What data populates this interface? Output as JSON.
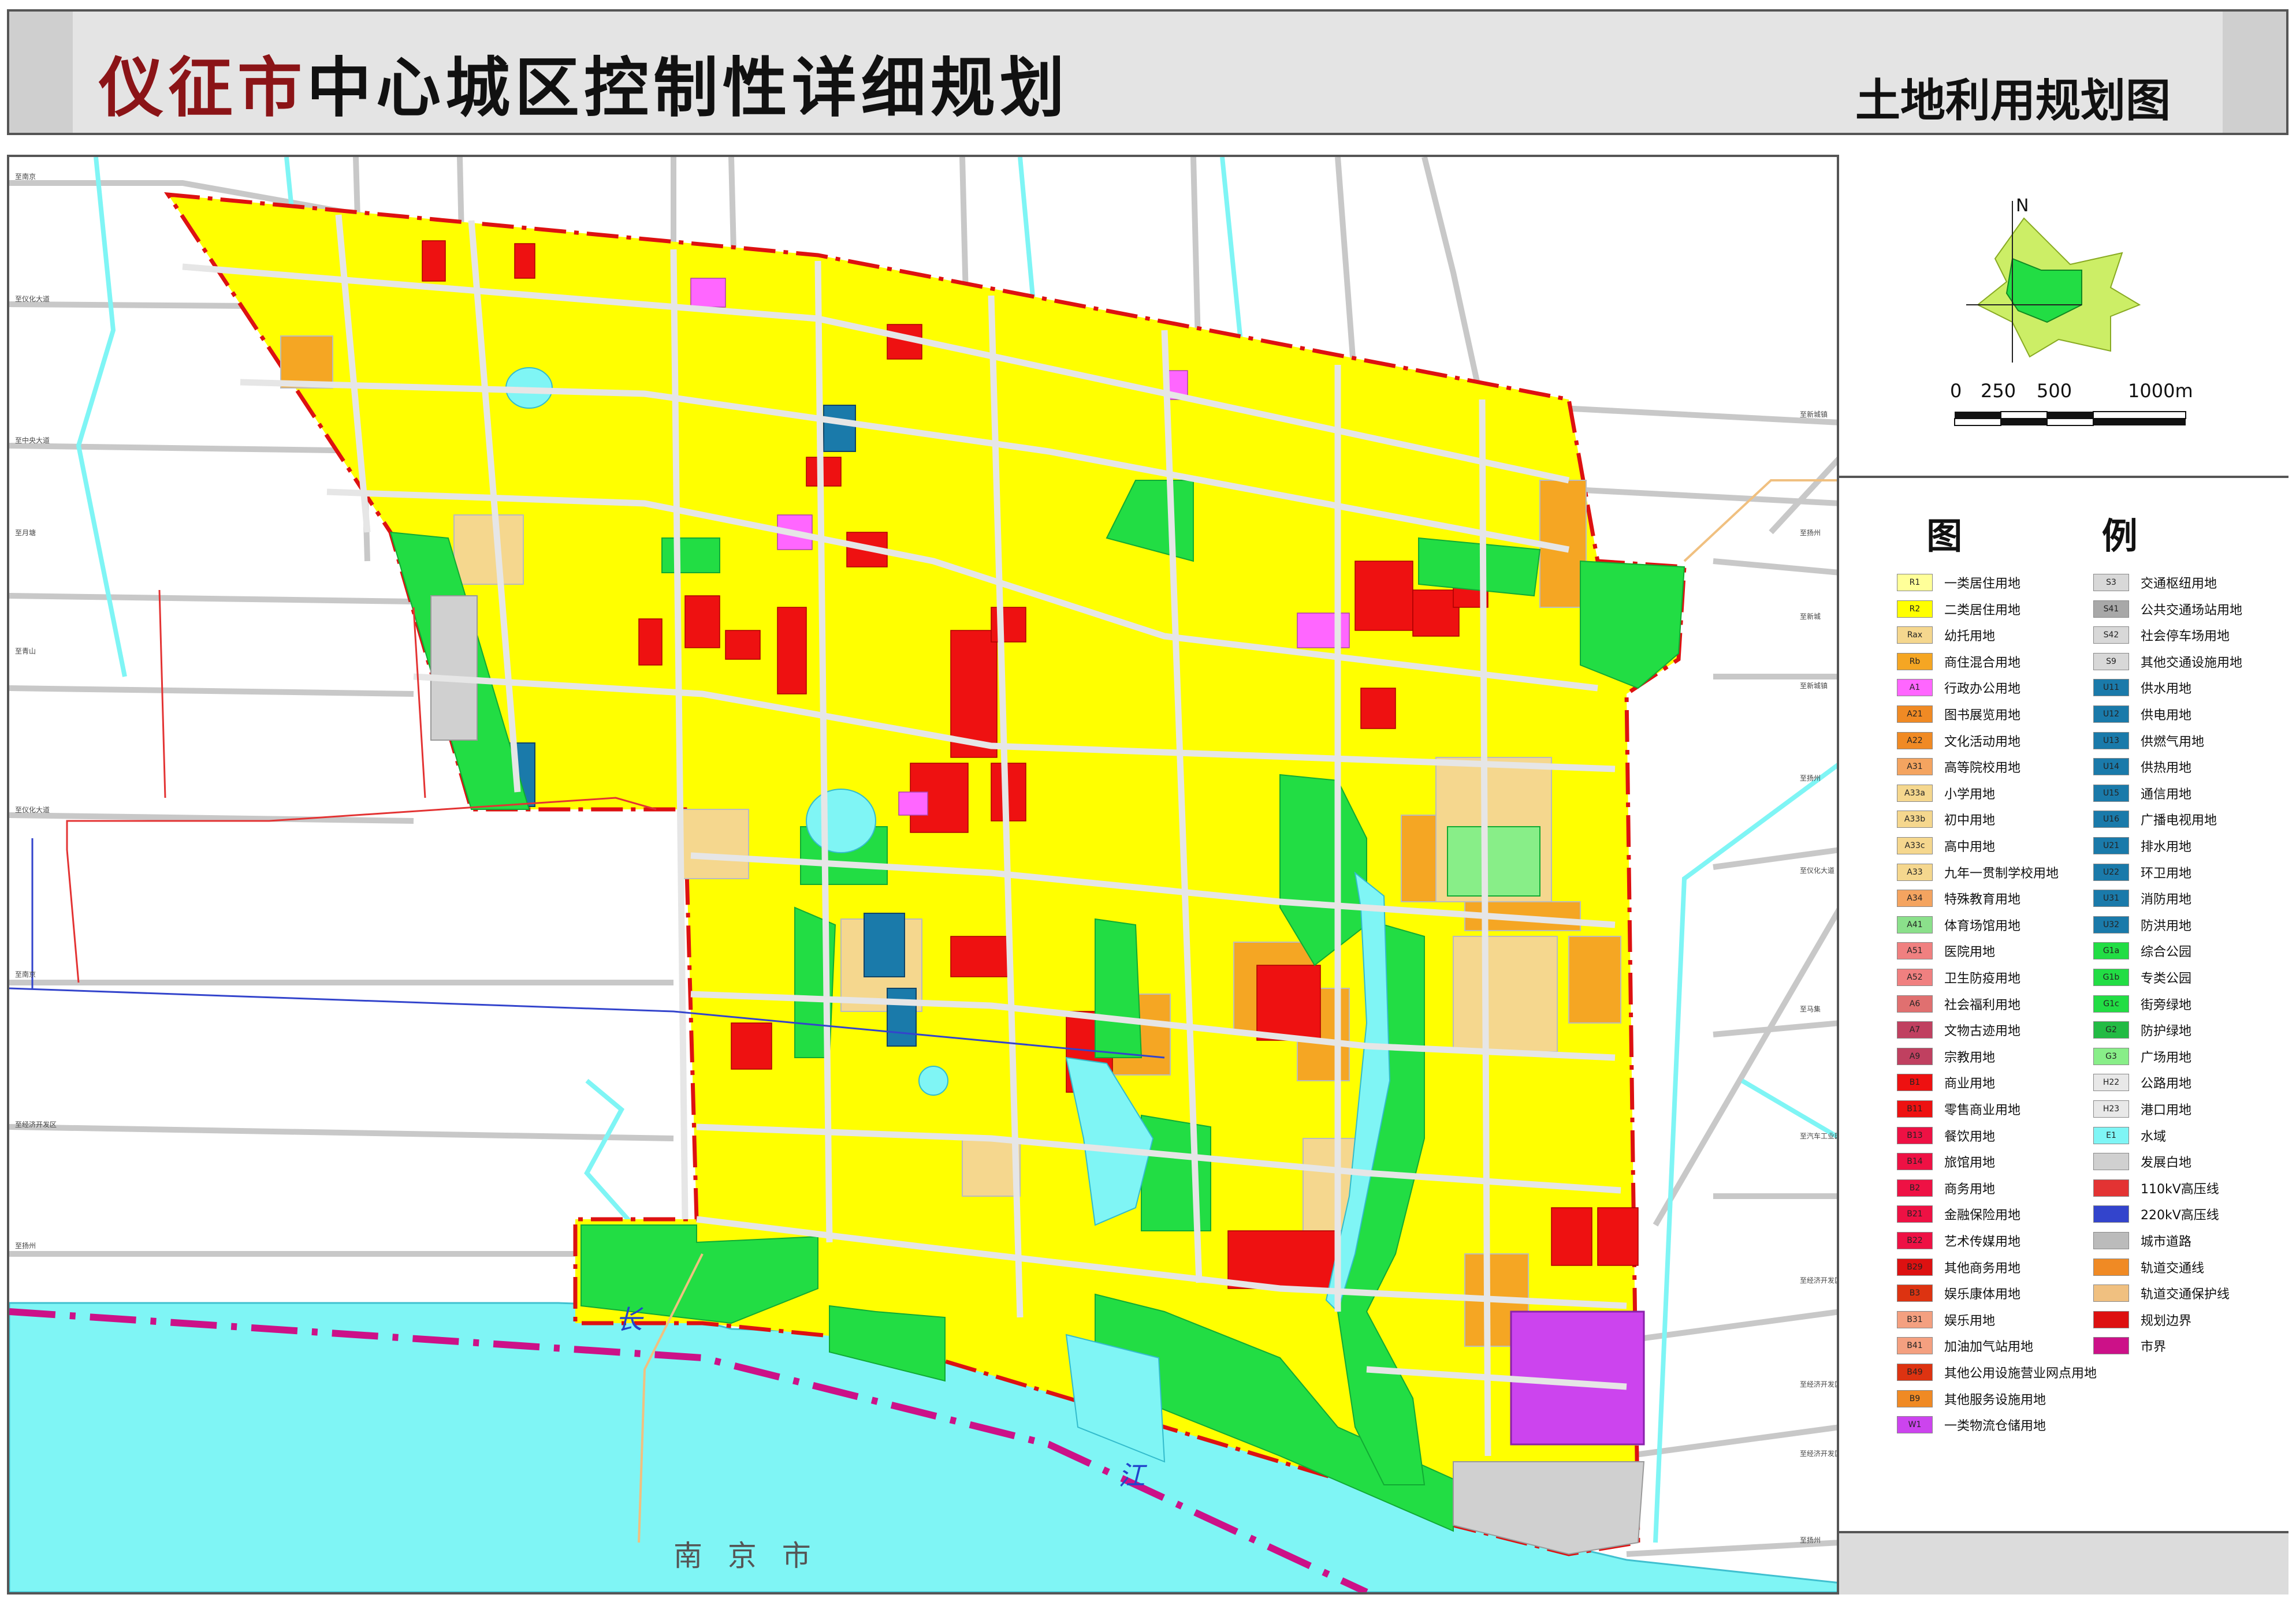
{
  "title": {
    "city": "仪征市",
    "main": "中心城区控制性详细规划",
    "subtitle": "土地利用规划图"
  },
  "compass": {
    "north": "N"
  },
  "scale_bar": {
    "ticks": [
      "0",
      "250",
      "500",
      "1000m"
    ]
  },
  "legend": {
    "title": "图  例",
    "left": [
      {
        "code": "R1",
        "label": "一类居住用地",
        "color": "#ffff99"
      },
      {
        "code": "R2",
        "label": "二类居住用地",
        "color": "#ffff00"
      },
      {
        "code": "Rax",
        "label": "幼托用地",
        "color": "#f5d78e"
      },
      {
        "code": "Rb",
        "label": "商住混合用地",
        "color": "#f5a623"
      },
      {
        "code": "A1",
        "label": "行政办公用地",
        "color": "#ff66ff"
      },
      {
        "code": "A21",
        "label": "图书展览用地",
        "color": "#f08a24"
      },
      {
        "code": "A22",
        "label": "文化活动用地",
        "color": "#f08a24"
      },
      {
        "code": "A31",
        "label": "高等院校用地",
        "color": "#f4a460"
      },
      {
        "code": "A33a",
        "label": "小学用地",
        "color": "#f5d78e"
      },
      {
        "code": "A33b",
        "label": "初中用地",
        "color": "#f5d78e"
      },
      {
        "code": "A33c",
        "label": "高中用地",
        "color": "#f5d78e"
      },
      {
        "code": "A33",
        "label": "九年一贯制学校用地",
        "color": "#f5d78e"
      },
      {
        "code": "A34",
        "label": "特殊教育用地",
        "color": "#f4a460"
      },
      {
        "code": "A41",
        "label": "体育场馆用地",
        "color": "#8be08b"
      },
      {
        "code": "A51",
        "label": "医院用地",
        "color": "#f08080"
      },
      {
        "code": "A52",
        "label": "卫生防疫用地",
        "color": "#f08080"
      },
      {
        "code": "A6",
        "label": "社会福利用地",
        "color": "#e07070"
      },
      {
        "code": "A7",
        "label": "文物古迹用地",
        "color": "#c04060"
      },
      {
        "code": "A9",
        "label": "宗教用地",
        "color": "#c04060"
      },
      {
        "code": "B1",
        "label": "商业用地",
        "color": "#ee1111"
      },
      {
        "code": "B11",
        "label": "零售商业用地",
        "color": "#ee1111"
      },
      {
        "code": "B13",
        "label": "餐饮用地",
        "color": "#ee1144"
      },
      {
        "code": "B14",
        "label": "旅馆用地",
        "color": "#ee1144"
      },
      {
        "code": "B2",
        "label": "商务用地",
        "color": "#ee1144"
      },
      {
        "code": "B21",
        "label": "金融保险用地",
        "color": "#ee1144"
      },
      {
        "code": "B22",
        "label": "艺术传媒用地",
        "color": "#ee1144"
      },
      {
        "code": "B29",
        "label": "其他商务用地",
        "color": "#dd1111"
      },
      {
        "code": "B3",
        "label": "娱乐康体用地",
        "color": "#dd3311"
      },
      {
        "code": "B31",
        "label": "娱乐用地",
        "color": "#f4a080"
      },
      {
        "code": "B41",
        "label": "加油加气站用地",
        "color": "#f4a080"
      },
      {
        "code": "B49",
        "label": "其他公用设施营业网点用地",
        "color": "#dd3311"
      },
      {
        "code": "B9",
        "label": "其他服务设施用地",
        "color": "#f08a24"
      },
      {
        "code": "W1",
        "label": "一类物流仓储用地",
        "color": "#cc44ee"
      }
    ],
    "right": [
      {
        "code": "S3",
        "label": "交通枢纽用地",
        "color": "#d8d8d8"
      },
      {
        "code": "S41",
        "label": "公共交通场站用地",
        "color": "#a8a8a8"
      },
      {
        "code": "S42",
        "label": "社会停车场用地",
        "color": "#d8d8d8"
      },
      {
        "code": "S9",
        "label": "其他交通设施用地",
        "color": "#d8d8d8"
      },
      {
        "code": "U11",
        "label": "供水用地",
        "color": "#1a7aaa"
      },
      {
        "code": "U12",
        "label": "供电用地",
        "color": "#1a7aaa"
      },
      {
        "code": "U13",
        "label": "供燃气用地",
        "color": "#1a7aaa"
      },
      {
        "code": "U14",
        "label": "供热用地",
        "color": "#1a7aaa"
      },
      {
        "code": "U15",
        "label": "通信用地",
        "color": "#1a7aaa"
      },
      {
        "code": "U16",
        "label": "广播电视用地",
        "color": "#1a7aaa"
      },
      {
        "code": "U21",
        "label": "排水用地",
        "color": "#1a7aaa"
      },
      {
        "code": "U22",
        "label": "环卫用地",
        "color": "#1a7aaa"
      },
      {
        "code": "U31",
        "label": "消防用地",
        "color": "#1a7aaa"
      },
      {
        "code": "U32",
        "label": "防洪用地",
        "color": "#1a7aaa"
      },
      {
        "code": "G1a",
        "label": "综合公园",
        "color": "#22dd44"
      },
      {
        "code": "G1b",
        "label": "专类公园",
        "color": "#22dd44"
      },
      {
        "code": "G1c",
        "label": "街旁绿地",
        "color": "#22dd44"
      },
      {
        "code": "G2",
        "label": "防护绿地",
        "color": "#22bb44"
      },
      {
        "code": "G3",
        "label": "广场用地",
        "color": "#88ee88"
      },
      {
        "code": "H22",
        "label": "公路用地",
        "color": "#e8e8e8"
      },
      {
        "code": "H23",
        "label": "港口用地",
        "color": "#e8e8e8"
      },
      {
        "code": "E1",
        "label": "水域",
        "color": "#7ff5f5"
      },
      {
        "code": "",
        "label": "发展白地",
        "color": "#d0d0d0"
      },
      {
        "code": "",
        "label": "110kV高压线",
        "color": "#e33333"
      },
      {
        "code": "",
        "label": "220kV高压线",
        "color": "#3344cc"
      },
      {
        "code": "",
        "label": "城市道路",
        "color": "#bbbbbb"
      },
      {
        "code": "",
        "label": "轨道交通线",
        "color": "#f08a24"
      },
      {
        "code": "",
        "label": "轨道交通保护线",
        "color": "#f0c080"
      },
      {
        "code": "",
        "label": "规划边界",
        "color": "#dd1111"
      },
      {
        "code": "",
        "label": "市界",
        "color": "#cc1188"
      }
    ]
  },
  "map_labels": {
    "river": [
      "长",
      "江"
    ],
    "nanjing": "南   京   市",
    "road_labels": [
      "至南京",
      "至仪化大道",
      "至中央大道",
      "至月塘",
      "至青山",
      "至仪化大道",
      "至南京",
      "至经济开发区",
      "至扬州",
      "至新城镇",
      "至扬州",
      "至新城",
      "至新城镇",
      "至扬州",
      "至仪化大道",
      "至马集",
      "至汽车工业园",
      "至经济开发区",
      "至经济开发区",
      "至经济开发区",
      "至扬州"
    ]
  }
}
